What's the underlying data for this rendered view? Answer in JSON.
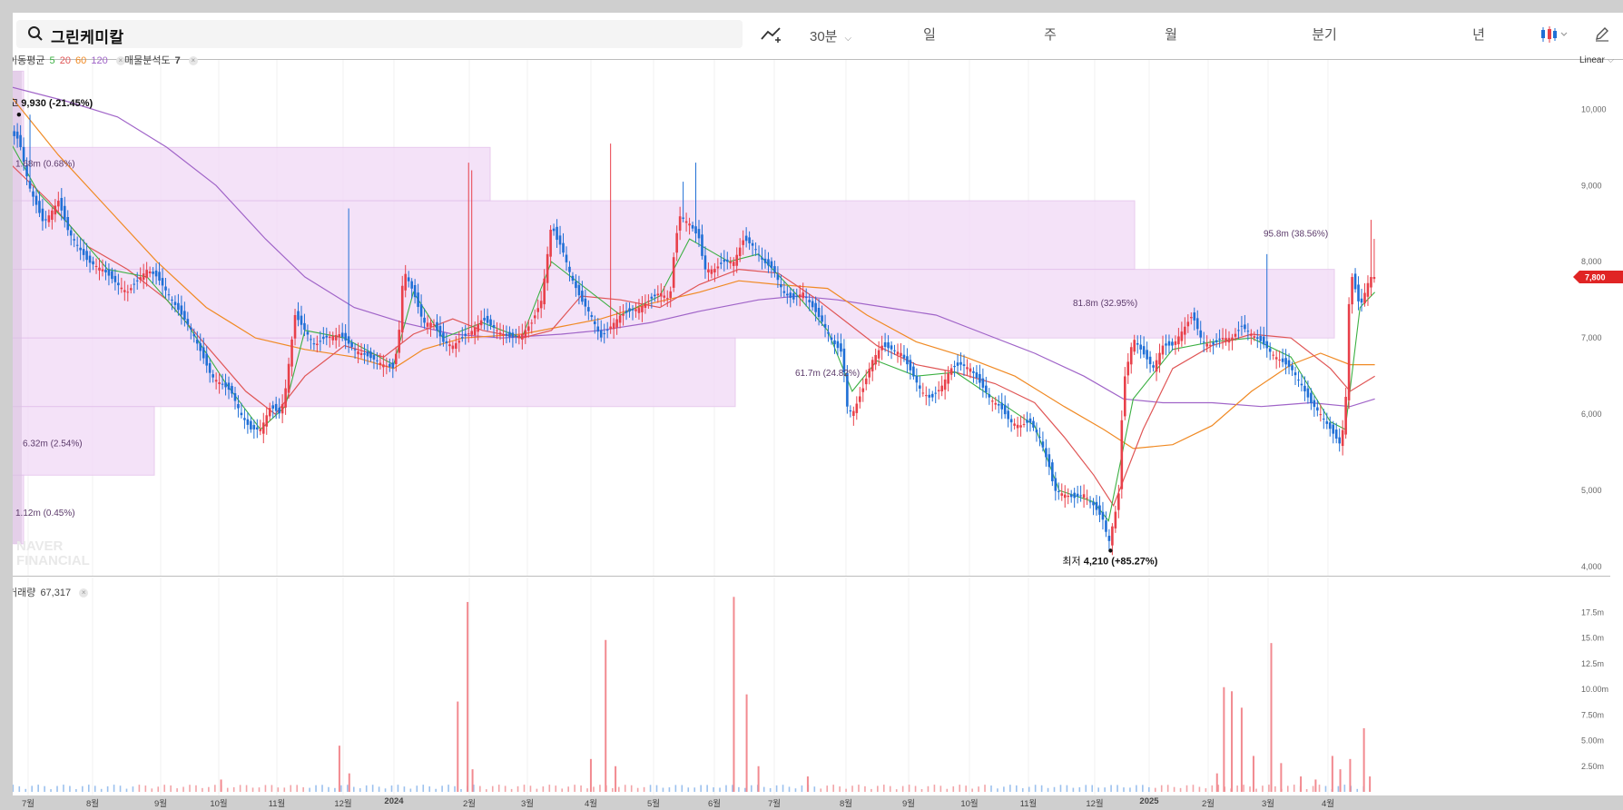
{
  "toolbar": {
    "stock_name": "그린케미칼",
    "interval": "30분",
    "tabs": [
      "일",
      "주",
      "월",
      "분기",
      "년"
    ],
    "active_tab": "일"
  },
  "legend": {
    "ma_label": "이동평균",
    "ma_periods": [
      {
        "label": "5",
        "color": "#3cb043"
      },
      {
        "label": "20",
        "color": "#e05656"
      },
      {
        "label": "60",
        "color": "#f08a24"
      },
      {
        "label": "120",
        "color": "#a064c8"
      }
    ],
    "volume_profile_label": "매물분석도",
    "volume_profile_value": "7",
    "volume_label": "거래량",
    "volume_value": "67,317"
  },
  "scale_mode": "Linear",
  "watermark": "NAVER FINANCIAL",
  "colors": {
    "up": "#e8404a",
    "down": "#1f6fd6",
    "profile": "#f3ddf7",
    "price_tag": "#e02424"
  },
  "chart_data": {
    "type": "candlestick",
    "x_months": [
      "7월",
      "8월",
      "9월",
      "10월",
      "11월",
      "12월",
      "2024",
      "2월",
      "3월",
      "4월",
      "5월",
      "6월",
      "7월",
      "8월",
      "9월",
      "10월",
      "11월",
      "12월",
      "2025",
      "2월",
      "3월",
      "4월"
    ],
    "y_ticks": [
      "10,000",
      "9,000",
      "8,000",
      "7,000",
      "6,000",
      "5,000",
      "4,000"
    ],
    "ylim": [
      4000,
      10600
    ],
    "volume_ticks": [
      "17.5m",
      "15.0m",
      "12.5m",
      "10.00m",
      "7.50m",
      "5.00m",
      "2.50m"
    ],
    "current_price": "7,800",
    "high_label": "최고",
    "high": "9,930 (-21.45%)",
    "low_label": "최저",
    "low": "4,210 (+85.27%)",
    "close_path": [
      [
        0,
        9700
      ],
      [
        10,
        9600
      ],
      [
        20,
        9000
      ],
      [
        35,
        8500
      ],
      [
        50,
        8800
      ],
      [
        60,
        8400
      ],
      [
        80,
        8000
      ],
      [
        95,
        7900
      ],
      [
        110,
        7700
      ],
      [
        120,
        7600
      ],
      [
        130,
        7750
      ],
      [
        140,
        7900
      ],
      [
        150,
        7800
      ],
      [
        160,
        7600
      ],
      [
        175,
        7300
      ],
      [
        185,
        7100
      ],
      [
        195,
        6800
      ],
      [
        205,
        6500
      ],
      [
        215,
        6400
      ],
      [
        225,
        6300
      ],
      [
        235,
        6000
      ],
      [
        245,
        5800
      ],
      [
        255,
        5800
      ],
      [
        265,
        6100
      ],
      [
        270,
        6050
      ],
      [
        275,
        6000
      ],
      [
        280,
        6300
      ],
      [
        290,
        7300
      ],
      [
        300,
        7100
      ],
      [
        310,
        6900
      ],
      [
        320,
        7000
      ],
      [
        335,
        7050
      ],
      [
        350,
        6850
      ],
      [
        365,
        6750
      ],
      [
        380,
        6650
      ],
      [
        390,
        6600
      ],
      [
        395,
        7000
      ],
      [
        400,
        7900
      ],
      [
        410,
        7600
      ],
      [
        420,
        7200
      ],
      [
        430,
        7200
      ],
      [
        440,
        6950
      ],
      [
        450,
        6900
      ],
      [
        460,
        7000
      ],
      [
        470,
        7100
      ],
      [
        480,
        7250
      ],
      [
        490,
        7150
      ],
      [
        500,
        7050
      ],
      [
        510,
        7000
      ],
      [
        520,
        7050
      ],
      [
        530,
        7200
      ],
      [
        540,
        7500
      ],
      [
        550,
        8500
      ],
      [
        555,
        8300
      ],
      [
        560,
        8200
      ],
      [
        570,
        7800
      ],
      [
        580,
        7500
      ],
      [
        590,
        7300
      ],
      [
        600,
        7000
      ],
      [
        610,
        7150
      ],
      [
        620,
        7300
      ],
      [
        630,
        7350
      ],
      [
        640,
        7400
      ],
      [
        650,
        7500
      ],
      [
        660,
        7600
      ],
      [
        670,
        7500
      ],
      [
        675,
        8200
      ],
      [
        680,
        8600
      ],
      [
        690,
        8500
      ],
      [
        700,
        8300
      ],
      [
        705,
        7900
      ],
      [
        715,
        7900
      ],
      [
        725,
        8000
      ],
      [
        735,
        8000
      ],
      [
        745,
        8300
      ],
      [
        755,
        8200
      ],
      [
        765,
        8000
      ],
      [
        775,
        7900
      ],
      [
        785,
        7600
      ],
      [
        795,
        7500
      ],
      [
        805,
        7600
      ],
      [
        815,
        7400
      ],
      [
        825,
        7200
      ],
      [
        835,
        6950
      ],
      [
        845,
        6800
      ],
      [
        850,
        6100
      ],
      [
        855,
        6000
      ],
      [
        865,
        6300
      ],
      [
        875,
        6700
      ],
      [
        885,
        6900
      ],
      [
        895,
        6850
      ],
      [
        905,
        6800
      ],
      [
        915,
        6550
      ],
      [
        925,
        6300
      ],
      [
        935,
        6200
      ],
      [
        945,
        6350
      ],
      [
        955,
        6600
      ],
      [
        965,
        6650
      ],
      [
        975,
        6600
      ],
      [
        985,
        6400
      ],
      [
        995,
        6200
      ],
      [
        1005,
        6100
      ],
      [
        1015,
        5900
      ],
      [
        1025,
        5850
      ],
      [
        1035,
        5900
      ],
      [
        1045,
        5700
      ],
      [
        1055,
        5300
      ],
      [
        1060,
        5000
      ],
      [
        1070,
        4950
      ],
      [
        1080,
        4900
      ],
      [
        1090,
        4950
      ],
      [
        1100,
        4800
      ],
      [
        1110,
        4600
      ],
      [
        1115,
        4300
      ],
      [
        1120,
        4600
      ],
      [
        1125,
        4900
      ],
      [
        1130,
        6400
      ],
      [
        1140,
        7000
      ],
      [
        1150,
        6800
      ],
      [
        1160,
        6600
      ],
      [
        1170,
        6900
      ],
      [
        1180,
        6900
      ],
      [
        1190,
        7100
      ],
      [
        1200,
        7300
      ],
      [
        1210,
        6950
      ],
      [
        1220,
        6900
      ],
      [
        1230,
        7000
      ],
      [
        1240,
        7000
      ],
      [
        1250,
        7150
      ],
      [
        1260,
        7050
      ],
      [
        1270,
        6950
      ],
      [
        1280,
        6800
      ],
      [
        1290,
        6700
      ],
      [
        1300,
        6600
      ],
      [
        1310,
        6400
      ],
      [
        1320,
        6150
      ],
      [
        1330,
        6000
      ],
      [
        1340,
        5800
      ],
      [
        1345,
        5700
      ],
      [
        1350,
        5600
      ],
      [
        1355,
        6000
      ],
      [
        1360,
        7900
      ],
      [
        1370,
        7400
      ],
      [
        1380,
        7800
      ]
    ],
    "ma5": [
      [
        0,
        9600
      ],
      [
        30,
        8900
      ],
      [
        60,
        8500
      ],
      [
        100,
        7900
      ],
      [
        140,
        7800
      ],
      [
        180,
        7200
      ],
      [
        220,
        6400
      ],
      [
        255,
        5800
      ],
      [
        280,
        6100
      ],
      [
        300,
        7100
      ],
      [
        340,
        7000
      ],
      [
        390,
        6650
      ],
      [
        410,
        7600
      ],
      [
        440,
        7000
      ],
      [
        480,
        7200
      ],
      [
        520,
        7000
      ],
      [
        550,
        8000
      ],
      [
        580,
        7700
      ],
      [
        620,
        7300
      ],
      [
        660,
        7550
      ],
      [
        690,
        8300
      ],
      [
        730,
        8000
      ],
      [
        760,
        8100
      ],
      [
        800,
        7550
      ],
      [
        830,
        7100
      ],
      [
        855,
        6300
      ],
      [
        880,
        6700
      ],
      [
        920,
        6500
      ],
      [
        960,
        6550
      ],
      [
        1000,
        6200
      ],
      [
        1040,
        5850
      ],
      [
        1065,
        5000
      ],
      [
        1100,
        4850
      ],
      [
        1115,
        4600
      ],
      [
        1140,
        6200
      ],
      [
        1180,
        6850
      ],
      [
        1220,
        6950
      ],
      [
        1260,
        7000
      ],
      [
        1300,
        6750
      ],
      [
        1340,
        5900
      ],
      [
        1355,
        5800
      ],
      [
        1370,
        7400
      ],
      [
        1385,
        7600
      ]
    ],
    "ma20": [
      [
        0,
        9300
      ],
      [
        40,
        8800
      ],
      [
        80,
        8200
      ],
      [
        120,
        7900
      ],
      [
        160,
        7500
      ],
      [
        200,
        6900
      ],
      [
        240,
        6300
      ],
      [
        270,
        6000
      ],
      [
        300,
        6500
      ],
      [
        340,
        6900
      ],
      [
        380,
        6750
      ],
      [
        410,
        7050
      ],
      [
        450,
        7250
      ],
      [
        480,
        7100
      ],
      [
        520,
        7000
      ],
      [
        550,
        7100
      ],
      [
        580,
        7550
      ],
      [
        620,
        7500
      ],
      [
        660,
        7400
      ],
      [
        700,
        7700
      ],
      [
        740,
        7900
      ],
      [
        780,
        7850
      ],
      [
        820,
        7500
      ],
      [
        850,
        7200
      ],
      [
        880,
        6900
      ],
      [
        920,
        6650
      ],
      [
        960,
        6550
      ],
      [
        1000,
        6400
      ],
      [
        1040,
        6150
      ],
      [
        1070,
        5700
      ],
      [
        1100,
        5200
      ],
      [
        1120,
        4800
      ],
      [
        1150,
        5800
      ],
      [
        1180,
        6600
      ],
      [
        1220,
        6900
      ],
      [
        1260,
        7050
      ],
      [
        1300,
        7000
      ],
      [
        1340,
        6600
      ],
      [
        1360,
        6300
      ],
      [
        1385,
        6500
      ]
    ],
    "ma60": [
      [
        0,
        10200
      ],
      [
        50,
        9400
      ],
      [
        100,
        8700
      ],
      [
        150,
        8000
      ],
      [
        200,
        7400
      ],
      [
        250,
        7000
      ],
      [
        300,
        6850
      ],
      [
        350,
        6750
      ],
      [
        390,
        6600
      ],
      [
        420,
        6850
      ],
      [
        460,
        7000
      ],
      [
        520,
        7050
      ],
      [
        560,
        7150
      ],
      [
        600,
        7250
      ],
      [
        650,
        7450
      ],
      [
        700,
        7600
      ],
      [
        740,
        7750
      ],
      [
        780,
        7700
      ],
      [
        830,
        7650
      ],
      [
        870,
        7300
      ],
      [
        920,
        6950
      ],
      [
        970,
        6750
      ],
      [
        1020,
        6500
      ],
      [
        1070,
        6100
      ],
      [
        1110,
        5800
      ],
      [
        1140,
        5550
      ],
      [
        1180,
        5600
      ],
      [
        1220,
        5850
      ],
      [
        1260,
        6300
      ],
      [
        1300,
        6650
      ],
      [
        1330,
        6800
      ],
      [
        1360,
        6650
      ],
      [
        1385,
        6650
      ]
    ],
    "ma120": [
      [
        0,
        10300
      ],
      [
        60,
        10100
      ],
      [
        110,
        9900
      ],
      [
        160,
        9500
      ],
      [
        210,
        9000
      ],
      [
        260,
        8300
      ],
      [
        300,
        7800
      ],
      [
        350,
        7400
      ],
      [
        400,
        7200
      ],
      [
        450,
        7050
      ],
      [
        500,
        7000
      ],
      [
        560,
        7050
      ],
      [
        600,
        7100
      ],
      [
        650,
        7200
      ],
      [
        700,
        7350
      ],
      [
        760,
        7500
      ],
      [
        800,
        7550
      ],
      [
        840,
        7500
      ],
      [
        890,
        7400
      ],
      [
        940,
        7300
      ],
      [
        990,
        7050
      ],
      [
        1040,
        6800
      ],
      [
        1090,
        6500
      ],
      [
        1130,
        6200
      ],
      [
        1170,
        6150
      ],
      [
        1220,
        6150
      ],
      [
        1270,
        6100
      ],
      [
        1320,
        6150
      ],
      [
        1360,
        6100
      ],
      [
        1385,
        6200
      ]
    ],
    "volume_profile": [
      {
        "low": 9500,
        "high": 10500,
        "volume": "",
        "w": 16
      },
      {
        "low": 8800,
        "high": 9500,
        "volume": "1.68m (0.68%)",
        "w": 530
      },
      {
        "low": 7900,
        "high": 8800,
        "volume": "",
        "w": 1240
      },
      {
        "low": 7000,
        "high": 7900,
        "volume": "95.8m (38.56%)",
        "w": 1460
      },
      {
        "low": 6100,
        "high": 7000,
        "volume": "61.7m (24.82%)",
        "w": 800
      },
      {
        "low": 5200,
        "high": 6100,
        "volume": "6.32m (2.54%)",
        "w": 160
      },
      {
        "low": 4300,
        "high": 5200,
        "volume": "1.12m (0.45%)",
        "w": 16
      }
    ],
    "profile_labels": [
      {
        "text": "1.68m (0.68%)",
        "price": 9250,
        "x": 3
      },
      {
        "text": "95.8m (38.56%)",
        "price": 8330,
        "x": 1378
      },
      {
        "text": "81.8m (32.95%)",
        "price": 7420,
        "x": 1168
      },
      {
        "text": "61.7m (24.82%)",
        "price": 6500,
        "x": 862
      },
      {
        "text": "6.32m (2.54%)",
        "price": 5580,
        "x": 11
      },
      {
        "text": "1.12m (0.45%)",
        "price": 4670,
        "x": 3
      }
    ],
    "volume_bars": [
      [
        215,
        1.2
      ],
      [
        335,
        4.5
      ],
      [
        345,
        1.8
      ],
      [
        455,
        8.8
      ],
      [
        465,
        18.5
      ],
      [
        470,
        2.2
      ],
      [
        590,
        3.2
      ],
      [
        605,
        14.8
      ],
      [
        615,
        2.5
      ],
      [
        735,
        19.0
      ],
      [
        748,
        9.5
      ],
      [
        760,
        2.5
      ],
      [
        810,
        1.5
      ],
      [
        1225,
        1.8
      ],
      [
        1232,
        10.2
      ],
      [
        1240,
        9.8
      ],
      [
        1250,
        8.2
      ],
      [
        1262,
        3.5
      ],
      [
        1280,
        14.5
      ],
      [
        1290,
        2.8
      ],
      [
        1310,
        1.5
      ],
      [
        1325,
        1.2
      ],
      [
        1342,
        3.5
      ],
      [
        1350,
        2.2
      ],
      [
        1360,
        3.2
      ],
      [
        1374,
        6.2
      ],
      [
        1380,
        1.5
      ]
    ]
  }
}
